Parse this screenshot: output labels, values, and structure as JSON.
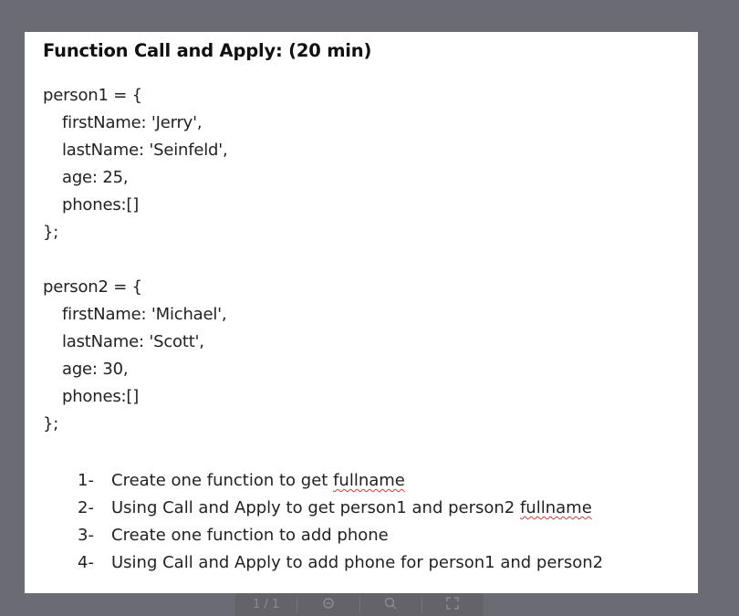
{
  "title": "Function Call and Apply: (20 min)",
  "code": {
    "person1": [
      "person1 = {",
      "firstName: 'Jerry',",
      "lastName: 'Seinfeld',",
      "age: 25,",
      "phones:[]",
      "};"
    ],
    "person2": [
      "person2 = {",
      "firstName: 'Michael',",
      "lastName: 'Scott',",
      "age: 30,",
      "phones:[]",
      "};"
    ]
  },
  "tasks": [
    {
      "num": "1-",
      "text": "Create one function to get ",
      "flag": "fullname"
    },
    {
      "num": "2-",
      "text": "Using Call and Apply to get person1 and person2 ",
      "flag": "fullname"
    },
    {
      "num": "3-",
      "text": "Create one function to add phone"
    },
    {
      "num": "4-",
      "text": "Using Call and Apply to add phone for person1 and person2"
    }
  ],
  "viewer": {
    "page_indicator": "1 / 1",
    "zoom_icon": "zoom-icon",
    "search_icon": "search-icon",
    "fullscreen_icon": "fullscreen-icon"
  }
}
